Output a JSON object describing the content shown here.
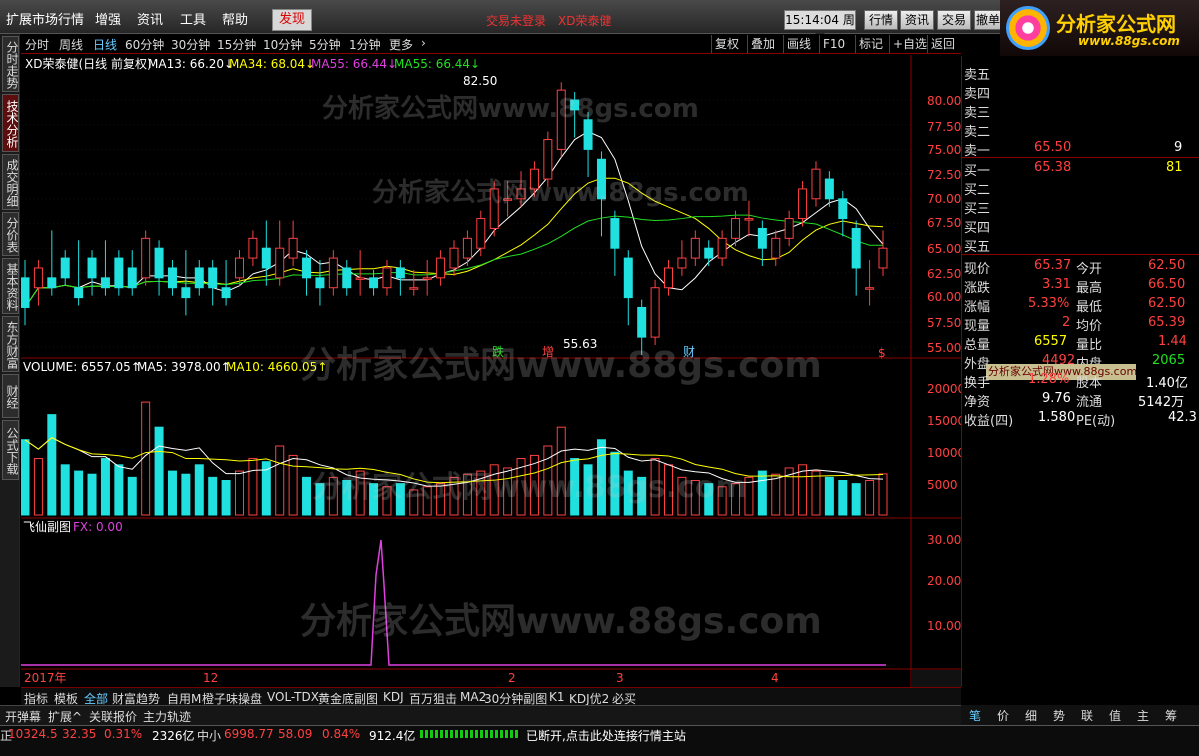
{
  "menubar": {
    "items": [
      "扩展市场行情",
      "增强",
      "资讯",
      "工具",
      "帮助"
    ],
    "discover": "发现",
    "login_status": "交易未登录",
    "stock_title": "XD荣泰健",
    "clock": "15:14:04 周二",
    "buttons": [
      "行情",
      "资讯",
      "交易",
      "撤单"
    ]
  },
  "logo": {
    "text": "分析家公式网",
    "url": "www.88gs.com"
  },
  "left_tabs": [
    "分时走势",
    "技术分析",
    "成交明细",
    "分价表",
    "基本资料",
    "东方财富",
    "财经",
    "公式下载"
  ],
  "period_bar": {
    "periods": [
      "分时",
      "周线",
      "日线",
      "60分钟",
      "30分钟",
      "15分钟",
      "10分钟",
      "5分钟",
      "1分钟",
      "更多"
    ],
    "active": "日线",
    "more_arrow": "›",
    "tools": [
      "复权",
      "叠加",
      "画线",
      "F10",
      "标记",
      "+自选",
      "返回"
    ]
  },
  "main_chart": {
    "title": "XD荣泰健(日线 前复权)",
    "ma13": "MA13: 66.20↓",
    "ma34": "MA34: 68.04↓",
    "ma55a": "MA55: 66.44↓",
    "ma55b": "MA55: 66.44↓",
    "high_label": "82.50",
    "low_label": "55.63",
    "markers": [
      "跌",
      "增",
      "财"
    ],
    "yaxis": [
      "80.00",
      "77.50",
      "75.00",
      "72.50",
      "70.00",
      "67.50",
      "65.00",
      "62.50",
      "60.00",
      "57.50",
      "55.00"
    ],
    "dollar": "$"
  },
  "volume_chart": {
    "title": "VOLUME: 6557.05↑",
    "ma5": "MA5: 3978.00↑",
    "ma10": "MA10: 4660.05↑",
    "yaxis": [
      "20000",
      "15000",
      "10000",
      "5000"
    ]
  },
  "sub_chart": {
    "title": "飞仙副图",
    "fx": "FX: 0.00",
    "yaxis": [
      "30.00",
      "20.00",
      "10.00"
    ]
  },
  "xaxis": {
    "labels": [
      "2017年",
      "12",
      "2",
      "3",
      "4"
    ],
    "period": "日线"
  },
  "watermarks": [
    "分析家公式网www.88gs.com",
    "分析家公式网www.88gs.com",
    "分析家公式网www.88gs.com",
    "分析家公式网www.88gs.com",
    "分析家公式网www.88gs.com"
  ],
  "orderbook": {
    "sell": [
      {
        "label": "卖五",
        "price": "",
        "vol": ""
      },
      {
        "label": "卖四",
        "price": "",
        "vol": ""
      },
      {
        "label": "卖三",
        "price": "",
        "vol": ""
      },
      {
        "label": "卖二",
        "price": "",
        "vol": ""
      },
      {
        "label": "卖一",
        "price": "65.50",
        "vol": "9"
      }
    ],
    "buy": [
      {
        "label": "买一",
        "price": "65.38",
        "vol": "81"
      },
      {
        "label": "买二",
        "price": "",
        "vol": ""
      },
      {
        "label": "买三",
        "price": "",
        "vol": ""
      },
      {
        "label": "买四",
        "price": "",
        "vol": ""
      },
      {
        "label": "买五",
        "price": "",
        "vol": ""
      }
    ]
  },
  "quote": {
    "rows": [
      [
        "现价",
        "65.37",
        "今开",
        "62.50"
      ],
      [
        "涨跌",
        "3.31",
        "最高",
        "66.50"
      ],
      [
        "涨幅",
        "5.33%",
        "最低",
        "62.50"
      ],
      [
        "现量",
        "2",
        "均价",
        "65.39"
      ],
      [
        "总量",
        "6557",
        "量比",
        "1.44"
      ],
      [
        "外盘",
        "4492",
        "内盘",
        "2065"
      ],
      [
        "换手",
        "1.28%",
        "股本",
        "1.40亿"
      ],
      [
        "净资",
        "9.76",
        "流通",
        "5142万"
      ],
      [
        "收益(四)",
        "1.580",
        "PE(动)",
        "42.3"
      ]
    ],
    "banner": "分析家公式网www.88gs.com"
  },
  "bottom_tabs": [
    "指标",
    "模板",
    "全部",
    "财富趋势",
    "自用M",
    "橙子味操盘",
    "VOL-TDX",
    "黄金底副图",
    "KDJ",
    "百万狙击",
    "MA2",
    "30分钟副图",
    "K1",
    "KDJ优2",
    "必买"
  ],
  "bottom_tabs_active": "全部",
  "axis_btns": [
    "+",
    "-",
    "0"
  ],
  "bottom_row2": [
    "开弹幕",
    "扩展^",
    "关联报价",
    "主力轨迹"
  ],
  "right_bottom_tabs": [
    "笔",
    "价",
    "细",
    "势",
    "联",
    "值",
    "主",
    "筹"
  ],
  "statusbar": {
    "idx1": "10324.5",
    "chg1": "32.35",
    "pct1": "0.31%",
    "amt1": "2326亿",
    "name2": "中小",
    "idx2": "6998.77",
    "chg2": "58.09",
    "pct2": "0.84%",
    "amt2": "912.4亿",
    "msg": "已断开,点击此处连接行情主站"
  },
  "chart_data": {
    "type": "candlestick",
    "ylim": [
      55.0,
      80.0
    ],
    "high": 82.5,
    "low": 55.63,
    "last": 65.37,
    "candles": [
      [
        62,
        63,
        59,
        58
      ],
      [
        61,
        61,
        63,
        60
      ],
      [
        62,
        66,
        61,
        61
      ],
      [
        64,
        64,
        62,
        63
      ],
      [
        61,
        65,
        60,
        61
      ],
      [
        64,
        63,
        62,
        61
      ],
      [
        62,
        65,
        61,
        61
      ],
      [
        64,
        62,
        61,
        62
      ],
      [
        63,
        64,
        61,
        61
      ],
      [
        62,
        64,
        66,
        66
      ],
      [
        65,
        64,
        62,
        61
      ],
      [
        63,
        63,
        61,
        61
      ],
      [
        61,
        64,
        60,
        59
      ],
      [
        63,
        62,
        61,
        62
      ],
      [
        63,
        62,
        61,
        60
      ],
      [
        61,
        63,
        60,
        60
      ],
      [
        62,
        62,
        64,
        63
      ],
      [
        64,
        65,
        66,
        64
      ],
      [
        65,
        67,
        63,
        62
      ],
      [
        62,
        63,
        65,
        67
      ],
      [
        64,
        65,
        66,
        67
      ],
      [
        64,
        63,
        62,
        61
      ],
      [
        62,
        63,
        61,
        60
      ],
      [
        61,
        62,
        64,
        61
      ],
      [
        63,
        62,
        61,
        61
      ],
      [
        62,
        64,
        62,
        61
      ],
      [
        62,
        62,
        61,
        61
      ],
      [
        61,
        62,
        63,
        62
      ],
      [
        63,
        63,
        62,
        61
      ],
      [
        61,
        62,
        61,
        61
      ],
      [
        62,
        63,
        62,
        61
      ],
      [
        62,
        63,
        64,
        63
      ],
      [
        63,
        64,
        65,
        64
      ],
      [
        64,
        65,
        66,
        64
      ],
      [
        65,
        67,
        68,
        66
      ],
      [
        67,
        69,
        71,
        69
      ],
      [
        70,
        71,
        70,
        69
      ],
      [
        70,
        72,
        71,
        70
      ],
      [
        71,
        72,
        73,
        71
      ],
      [
        72,
        74,
        76,
        73
      ],
      [
        75,
        78,
        81,
        79
      ],
      [
        80,
        80,
        79,
        77
      ],
      [
        78,
        76,
        75,
        73
      ],
      [
        74,
        72,
        70,
        67
      ],
      [
        68,
        67,
        65,
        63
      ],
      [
        64,
        62,
        60,
        58
      ],
      [
        59,
        57,
        56,
        55
      ],
      [
        56,
        59,
        61,
        60
      ],
      [
        61,
        62,
        63,
        63
      ],
      [
        63,
        65,
        64,
        64
      ],
      [
        64,
        65,
        66,
        65
      ],
      [
        65,
        65,
        64,
        64
      ],
      [
        64,
        65,
        66,
        66
      ],
      [
        66,
        67,
        68,
        68
      ],
      [
        68,
        69,
        68,
        67
      ],
      [
        67,
        66,
        65,
        64
      ],
      [
        64,
        65,
        66,
        66
      ],
      [
        66,
        67,
        68,
        68
      ],
      [
        68,
        70,
        71,
        70
      ],
      [
        70,
        72,
        73,
        72
      ],
      [
        72,
        71,
        70,
        70
      ],
      [
        70,
        69,
        68,
        67
      ],
      [
        67,
        65,
        63,
        61
      ],
      [
        61,
        60,
        61,
        63
      ],
      [
        63,
        64,
        65,
        66
      ]
    ],
    "volume": [
      12000,
      9000,
      16000,
      8000,
      7000,
      6500,
      9000,
      8000,
      6000,
      18000,
      14000,
      7000,
      6500,
      8000,
      6000,
      5500,
      7000,
      9000,
      8500,
      11000,
      9500,
      6000,
      5000,
      6000,
      5500,
      7000,
      5000,
      4500,
      5000,
      4000,
      4500,
      5000,
      6000,
      6500,
      7000,
      8000,
      7500,
      9000,
      9500,
      11000,
      14000,
      9000,
      8000,
      12000,
      10000,
      7000,
      6000,
      9000,
      8000,
      6000,
      5500,
      5000,
      4500,
      5000,
      6000,
      7000,
      6500,
      7500,
      8000,
      7000,
      6000,
      5500,
      5000,
      5500,
      6557
    ]
  }
}
